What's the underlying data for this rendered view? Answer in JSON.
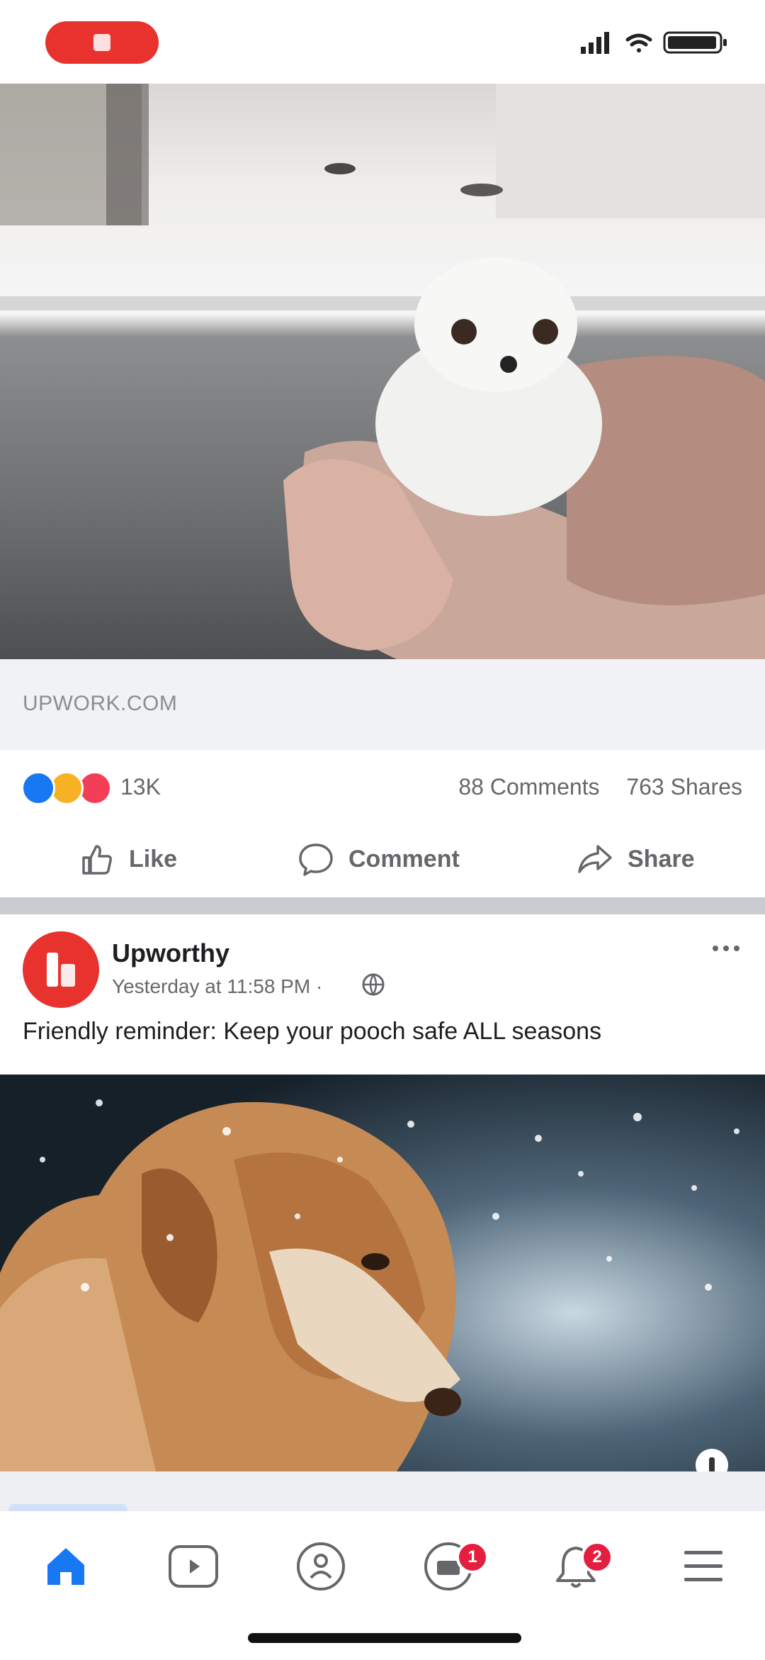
{
  "status_bar": {
    "icons": [
      "signal-icon",
      "wifi-icon",
      "battery-icon"
    ]
  },
  "post1": {
    "link_domain": "UPWORK.COM",
    "reaction_count": "13K",
    "comments": "88 Comments",
    "shares": "763 Shares",
    "actions": {
      "like": "Like",
      "comment": "Comment",
      "share": "Share"
    }
  },
  "post2": {
    "page_name": "Upworthy",
    "timestamp": "Yesterday at 11:58 PM ·",
    "text": "Friendly reminder: Keep your pooch safe ALL seasons"
  },
  "tabbar": {
    "tabs": [
      "home-tab",
      "watch-tab",
      "groups-tab",
      "marketplace-tab",
      "notifications-tab",
      "menu-tab"
    ],
    "badges": {
      "marketplace": "1",
      "notifications": "2"
    }
  },
  "colors": {
    "brand_blue": "#1877f2",
    "upworthy_red": "#e8322e",
    "badge_red": "#e41e3f",
    "muted_text": "#65676b"
  }
}
